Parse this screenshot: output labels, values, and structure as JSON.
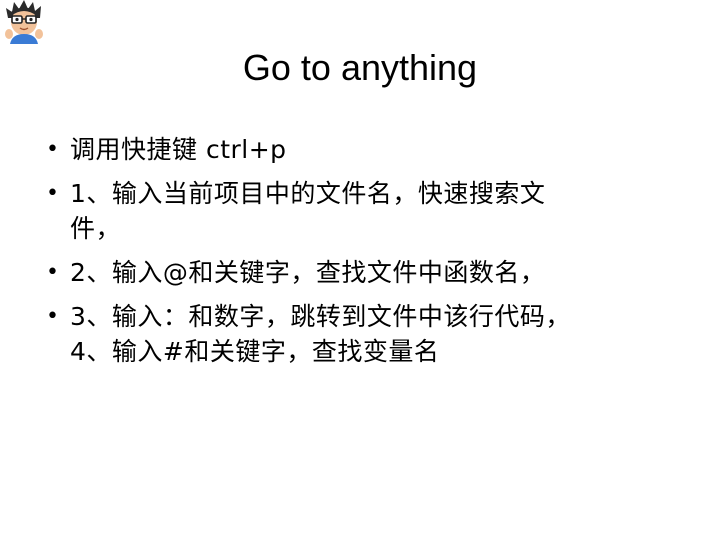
{
  "slide": {
    "title": "Go to anything",
    "bullets": [
      {
        "lines": [
          "调用快捷键 ctrl+p"
        ]
      },
      {
        "lines": [
          "1、输入当前项目中的文件名，快速搜索文",
          "件，"
        ]
      },
      {
        "lines": [
          "2、输入@和关键字，查找文件中函数名，"
        ]
      },
      {
        "lines": [
          "3、输入：和数字，跳转到文件中该行代码，",
          "4、输入#和关键字，查找变量名"
        ]
      }
    ],
    "bullet_glyph": "•"
  },
  "colors": {
    "background": "#ffffff",
    "text": "#000000"
  },
  "icons": {
    "avatar": "cartoon-avatar-icon"
  }
}
